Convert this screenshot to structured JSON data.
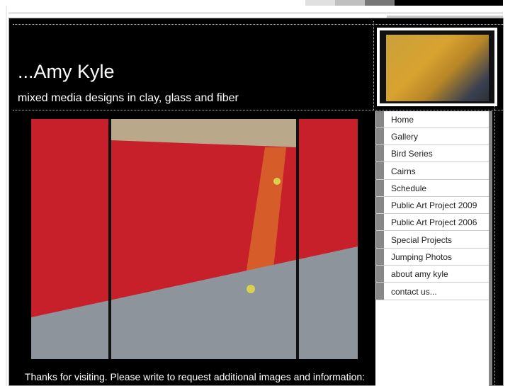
{
  "header": {
    "title": "...Amy Kyle",
    "subtitle": "mixed media designs in clay, glass and fiber"
  },
  "colors": {
    "swatches": [
      "#e0e0e0",
      "#c0c0c0",
      "#777777",
      "#000000"
    ],
    "background": "#000000"
  },
  "nav": {
    "items": [
      {
        "label": "Home"
      },
      {
        "label": "Gallery"
      },
      {
        "label": "Bird Series"
      },
      {
        "label": "Cairns"
      },
      {
        "label": "Schedule"
      },
      {
        "label": "Public Art Project 2009"
      },
      {
        "label": "Public Art Project 2006"
      },
      {
        "label": "Special Projects"
      },
      {
        "label": "Jumping Photos"
      },
      {
        "label": "about amy kyle"
      },
      {
        "label": "contact us..."
      }
    ]
  },
  "footer": {
    "text": "Thanks for visiting. Please write to request additional images and information:"
  }
}
